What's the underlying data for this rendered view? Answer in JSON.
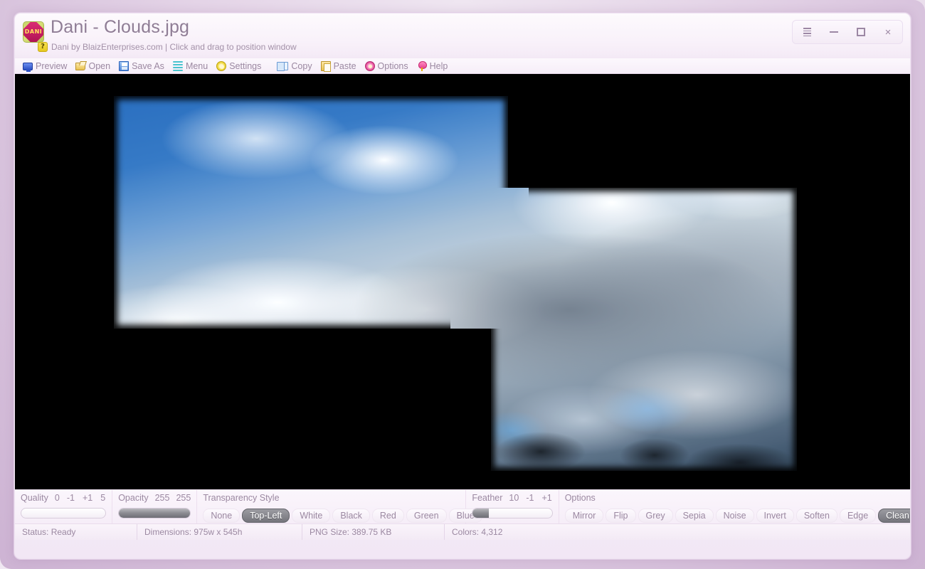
{
  "window": {
    "title": "Dani - Clouds.jpg",
    "subtitle": "Dani by BlaizEnterprises.com | Click and drag to position window",
    "logo_text": "DANI",
    "help_badge": "?",
    "controls": [
      {
        "name": "window-menu-icon",
        "glyph": "stack"
      },
      {
        "name": "minimize-icon",
        "glyph": "minimize"
      },
      {
        "name": "maximize-icon",
        "glyph": "maximize"
      },
      {
        "name": "close-icon",
        "glyph": "×"
      }
    ],
    "frame_color": "#cdb3d3",
    "accent_color": "#9b88a1"
  },
  "toolbar": {
    "items": [
      {
        "label": "Preview",
        "icon": "monitor-icon"
      },
      {
        "label": "Open",
        "icon": "folder-open-icon"
      },
      {
        "label": "Save As",
        "icon": "floppy-disk-icon"
      },
      {
        "label": "Menu",
        "icon": "list-lines-icon"
      },
      {
        "label": "Settings",
        "icon": "gear-icon"
      },
      {
        "label": "Copy",
        "icon": "copy-pages-icon"
      },
      {
        "label": "Paste",
        "icon": "clipboard-icon"
      },
      {
        "label": "Options",
        "icon": "flower-gear-icon"
      },
      {
        "label": "Help",
        "icon": "balloon-icon"
      }
    ]
  },
  "canvas": {
    "background_color": "#000000",
    "image_name": "Clouds.jpg"
  },
  "controls": {
    "quality": {
      "label": "Quality",
      "value": "0",
      "dec": "-1",
      "inc": "+1",
      "step": "5",
      "fill_percent": 0
    },
    "opacity": {
      "label": "Opacity",
      "value": "255",
      "value_right": "255",
      "fill_percent": 100
    },
    "transparency": {
      "label": "Transparency Style",
      "options": [
        "None",
        "Top-Left",
        "White",
        "Black",
        "Red",
        "Green",
        "Blue"
      ],
      "selected": "Top-Left"
    },
    "feather": {
      "label": "Feather",
      "value": "10",
      "dec": "-1",
      "inc": "+1",
      "fill_percent": 20
    },
    "options": {
      "label": "Options",
      "items": [
        "Mirror",
        "Flip",
        "Grey",
        "Sepia",
        "Noise",
        "Invert",
        "Soften",
        "Edge",
        "Clean"
      ],
      "selected": "Clean"
    }
  },
  "status": {
    "cells": [
      "Status: Ready",
      "Dimensions: 975w x 545h",
      "PNG Size: 389.75 KB",
      "Colors: 4,312"
    ]
  }
}
